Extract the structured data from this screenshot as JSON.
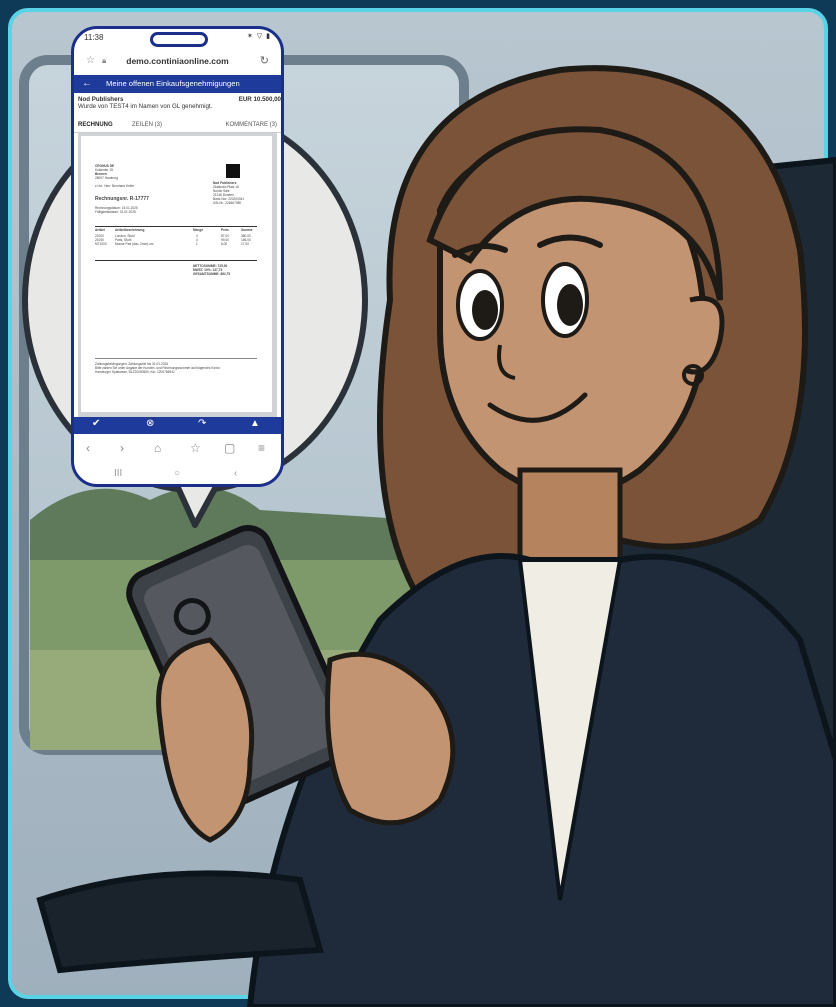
{
  "phone": {
    "status_time": "11:38",
    "status_icons": "✶ ▽ ▮",
    "url": "demo.continiaonline.com",
    "app_title": "Meine offenen Einkaufsgenehmigungen",
    "vendor_name": "Nod Publishers",
    "vendor_amount": "EUR 10.500,00",
    "vendor_note": "Wurde von TEST4 im Namen von GL genehmigt.",
    "tabs": [
      "RECHNUNG",
      "ZEILEN (3)",
      "KOMMENTARE (3)"
    ],
    "document": {
      "sender_lines": [
        "CRONUS DE",
        "Kollander 15",
        "Bremen",
        "28007 Hamburg"
      ],
      "contact": "z.Hd.: Herr. Bernhard Keller",
      "invoice_title": "Rechnungsnr. R-17777",
      "dates": [
        "Rechnungsdatum: 15.01.2025",
        "Fälligkeitsdatum: 31.01.2025"
      ],
      "recipient_lines": [
        "Nod Publishers",
        "Glastudio Platz 16",
        "Nordic Sale",
        "21246 Dorsten",
        "Bank-Nor: 220200041",
        "USt-Nr.: 226467080"
      ],
      "table_headers": [
        "Artikel",
        "Artikelbezeichnung",
        "Menge",
        "Preis",
        "Summe"
      ],
      "table_rows": [
        [
          "21000",
          "London, Stuhl",
          "4",
          "87,00",
          "380,00"
        ],
        [
          "21050",
          "Paris, Stuhl",
          "4",
          "99,00",
          "156,00"
        ],
        [
          "MT1000",
          "Mouse Pad (dau. 2mm) cm",
          "1",
          "8,00",
          "17,00"
        ]
      ],
      "totals": [
        "NETTOSUMME: 725,00",
        "MWST. 19%: 137,75",
        "GESAMTSUMME: 862,75"
      ],
      "footer_lines": [
        "Zahlungsbedingungen: Zahlungsziel bis 31.01.2025",
        "Bitte zahlen Sie unter Angabe der Kunden- und Rechnungsnummer auf folgendes Konto:",
        "Hamburger Sparkasse, BLZ20050550, Kto. 1200766942"
      ]
    },
    "action_icons": [
      "check-icon",
      "reject-icon",
      "forward-icon",
      "warning-icon"
    ],
    "action_glyphs": [
      "✔",
      "⊗",
      "↷",
      "▲"
    ],
    "browser_nav": [
      "‹",
      "›",
      "⌂",
      "☆",
      "▢",
      "≡"
    ],
    "system_nav": [
      "III",
      "○",
      "‹"
    ]
  },
  "colors": {
    "frame": "#0f3a57",
    "phone_border": "#1b2f8a",
    "app_bar": "#1e3a9a",
    "jacket": "#1f2b3a",
    "hair": "#7a5338",
    "skin": "#c39472"
  }
}
